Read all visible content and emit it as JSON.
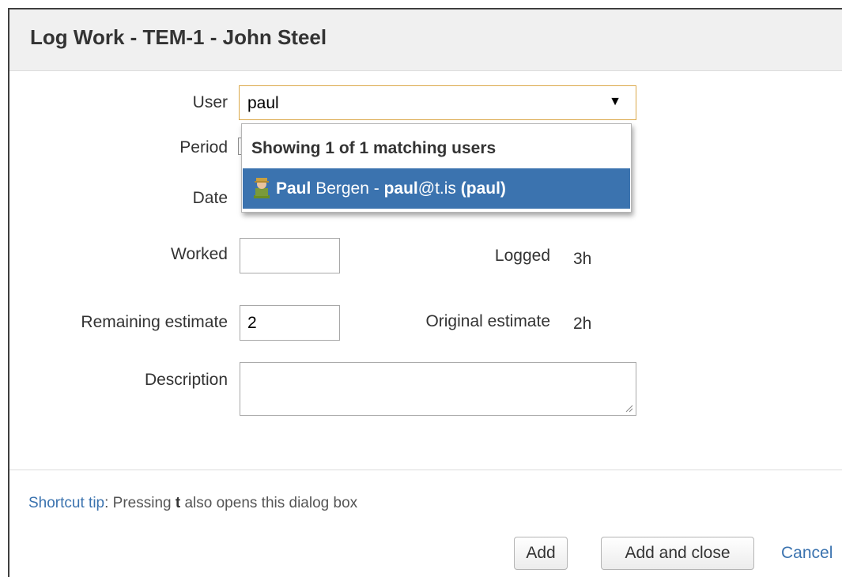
{
  "dialog": {
    "title": "Log Work - TEM-1 - John Steel"
  },
  "form": {
    "user_label": "User",
    "user_value": "paul",
    "period_label": "Period",
    "date_label": "Date",
    "worked_label": "Worked",
    "worked_value": "",
    "logged_label": "Logged",
    "logged_value": "3h",
    "remaining_label": "Remaining estimate",
    "remaining_value": "2",
    "original_label": "Original estimate",
    "original_value": "2h",
    "description_label": "Description",
    "description_value": ""
  },
  "user_suggestions": {
    "heading": "Showing 1 of 1 matching users",
    "items": [
      {
        "name_match": "Paul",
        "name_rest": " Bergen - ",
        "email_match": "paul",
        "email_rest": "@t.is ",
        "username": "(paul)",
        "avatar_icon": "user-avatar-icon"
      }
    ]
  },
  "footer": {
    "tip_link": "Shortcut tip",
    "tip_prefix": ": Pressing ",
    "tip_key": "t",
    "tip_suffix": " also opens this dialog box",
    "add_label": "Add",
    "add_close_label": "Add and close",
    "cancel_label": "Cancel"
  },
  "colors": {
    "accent": "#3b73af",
    "header_bg": "#f0f0f0",
    "focus_border": "#dba84a"
  }
}
